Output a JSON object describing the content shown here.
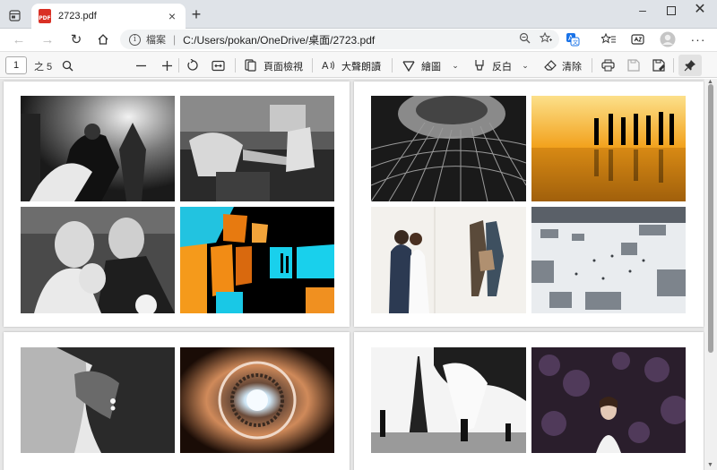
{
  "tab": {
    "title": "2723.pdf",
    "badge": "PDF"
  },
  "address": {
    "label": "檔案",
    "url": "C:/Users/pokan/OneDrive/桌面/2723.pdf"
  },
  "pdf_toolbar": {
    "page_number": "1",
    "page_total": "之 5",
    "page_view_label": "頁面檢視",
    "read_aloud_label": "大聲朗讀",
    "draw_label": "繪圖",
    "highlight_label": "反白",
    "erase_label": "清除"
  },
  "icons": {
    "tab_actions": "tab-actions-icon",
    "close": "close-icon",
    "new_tab": "plus-icon",
    "minimize": "minimize-icon",
    "maximize": "maximize-icon",
    "window_close": "window-close-icon",
    "back": "back-arrow-icon",
    "forward": "forward-arrow-icon",
    "refresh": "refresh-icon",
    "home": "home-icon",
    "info": "info-icon",
    "zoom": "zoom-icon",
    "favorite_add": "favorite-add-icon",
    "translate": "translate-icon",
    "favorites": "favorites-icon",
    "collections": "collections-icon",
    "profile": "profile-avatar",
    "more": "more-icon",
    "search": "search-icon",
    "zoom_out": "zoom-out-icon",
    "zoom_in": "zoom-in-icon",
    "rotate": "rotate-icon",
    "fit_width": "fit-width-icon",
    "print": "print-icon",
    "save": "save-icon",
    "save_as": "save-as-icon",
    "pin": "pin-icon"
  },
  "colors": {
    "tabstrip_bg": "#dfe3e8",
    "pdf_badge": "#d93025",
    "translate_accent": "#1a73e8",
    "viewer_bg": "#e7e7e7"
  }
}
